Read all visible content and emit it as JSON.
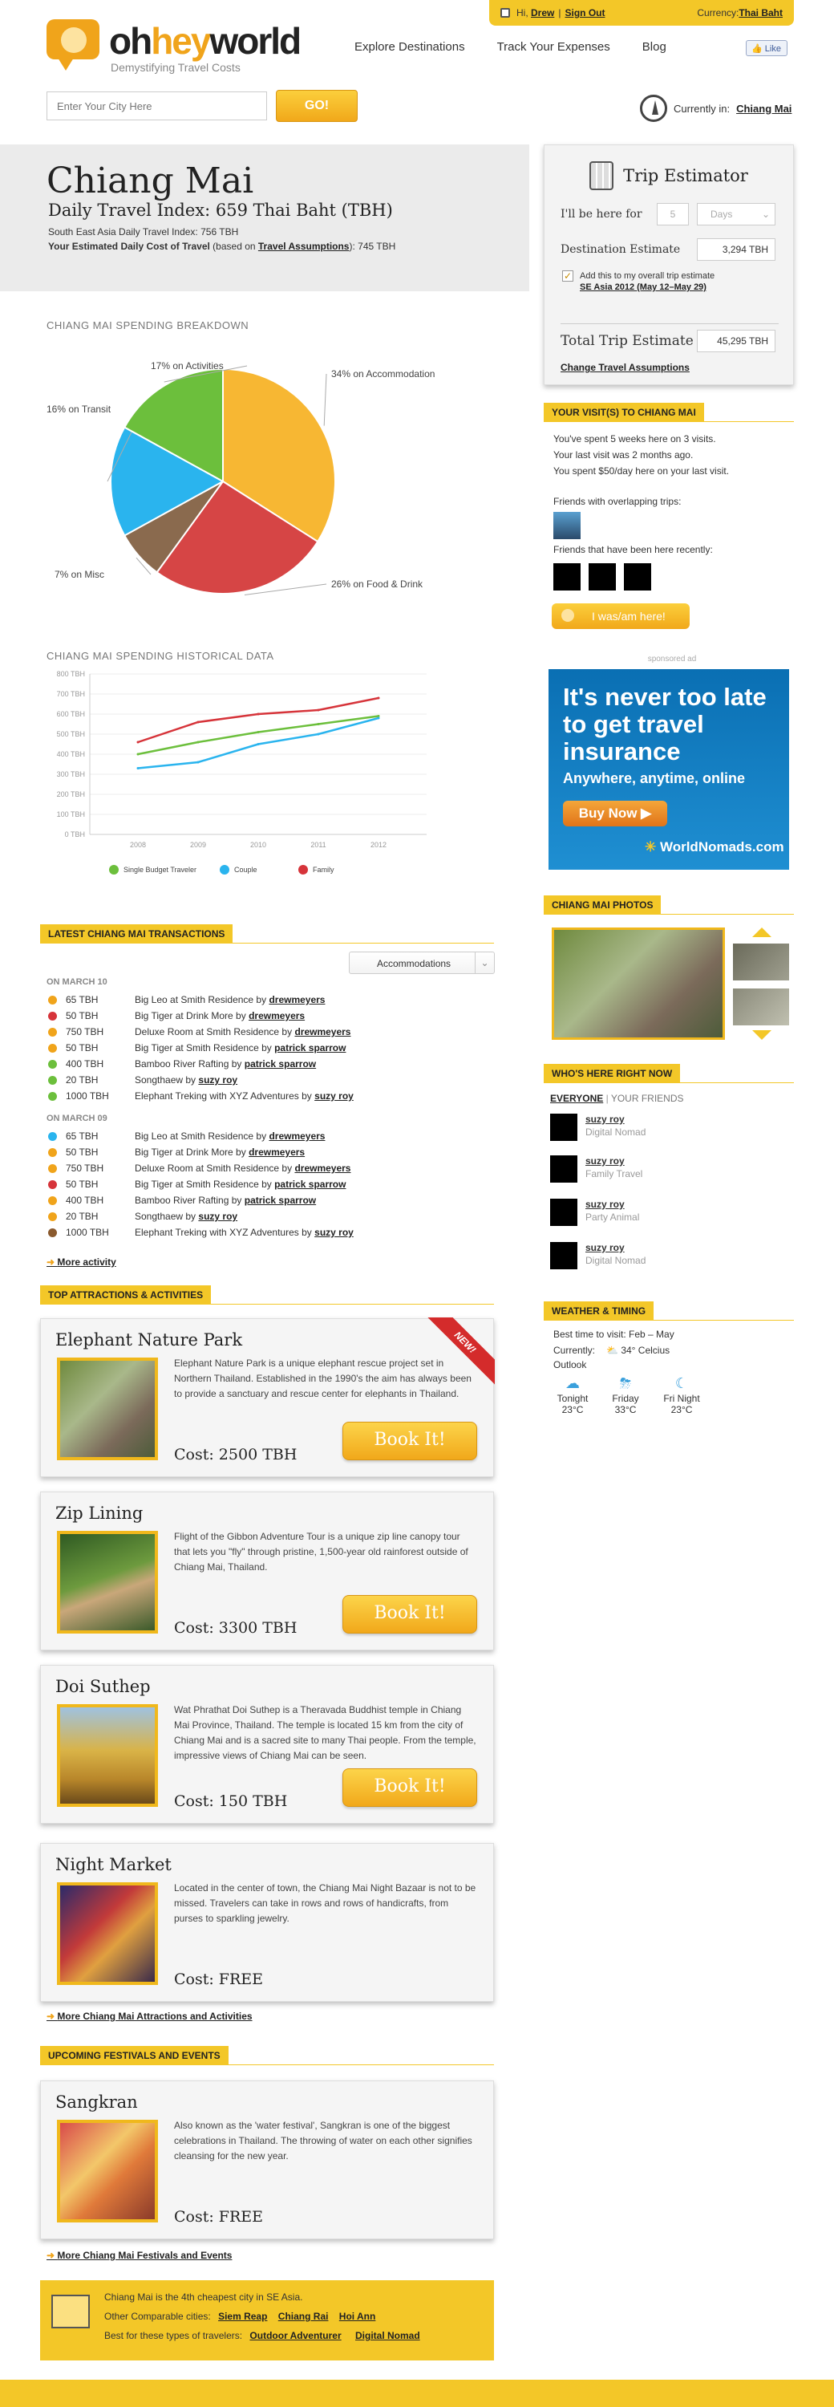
{
  "userbar": {
    "greeting": "Hi,",
    "user": "Drew",
    "signout": "Sign Out",
    "currency_label": "Currency:",
    "currency": "Thai Baht"
  },
  "header": {
    "logo_oh": "oh",
    "logo_hey": "hey",
    "logo_world": "world",
    "tagline": "Demystifying Travel Costs",
    "nav": [
      "Explore Destinations",
      "Track Your Expenses",
      "Blog"
    ],
    "like": "Like",
    "search_placeholder": "Enter Your City Here",
    "go": "GO!",
    "currently_in_label": "Currently in:",
    "currently_in_city": "Chiang Mai"
  },
  "city": {
    "name": "Chiang Mai",
    "daily_index": "Daily Travel Index: 659 Thai Baht (TBH)",
    "sea_index": "South East Asia Daily Travel Index: 756 TBH",
    "est_prefix": "Your Estimated Daily Cost of Travel",
    "est_mid": " (based on ",
    "est_link": "Travel Assumptions",
    "est_suffix": "): 745 TBH"
  },
  "estimator": {
    "title": "Trip Estimator",
    "here_for": "I'll be here for",
    "days_value": "5",
    "days_unit": "Days",
    "dest_label": "Destination Estimate",
    "dest_value": "3,294 TBH",
    "add_text": "Add this to my overall trip estimate",
    "add_link": "SE Asia 2012 (May 12–May 29)",
    "total_label": "Total Trip Estimate",
    "total_value": "45,295 TBH",
    "change_link": "Change Travel Assumptions"
  },
  "breakdown": {
    "title": "CHIANG MAI SPENDING BREAKDOWN"
  },
  "chart_data": [
    {
      "type": "pie",
      "title": "CHIANG MAI SPENDING BREAKDOWN",
      "slices": [
        {
          "label": "34% on Accommodation",
          "value": 34,
          "color": "#f7b733"
        },
        {
          "label": "26% on Food & Drink",
          "value": 26,
          "color": "#d64545"
        },
        {
          "label": "7% on Misc",
          "value": 7,
          "color": "#8a6a4e"
        },
        {
          "label": "16% on Transit",
          "value": 16,
          "color": "#2ab4ee"
        },
        {
          "label": "17% on Activities",
          "value": 17,
          "color": "#6cbf3c"
        }
      ]
    },
    {
      "type": "line",
      "title": "CHIANG MAI SPENDING HISTORICAL DATA",
      "x": [
        "2008",
        "2009",
        "2010",
        "2011",
        "2012"
      ],
      "y_ticks": [
        "0 TBH",
        "100 TBH",
        "200 TBH",
        "300 TBH",
        "400 TBH",
        "500 TBH",
        "600 TBH",
        "700 TBH",
        "800 TBH"
      ],
      "ylim": [
        0,
        800
      ],
      "series": [
        {
          "name": "Single Budget Traveler",
          "color": "#6cbf3c",
          "values": [
            400,
            460,
            510,
            550,
            590
          ]
        },
        {
          "name": "Couple",
          "color": "#2ab4ee",
          "values": [
            330,
            360,
            450,
            500,
            580
          ]
        },
        {
          "name": "Family",
          "color": "#d6343a",
          "values": [
            460,
            560,
            600,
            620,
            680
          ]
        }
      ]
    }
  ],
  "history": {
    "title": "CHIANG MAI SPENDING HISTORICAL DATA"
  },
  "transactions": {
    "title": "LATEST CHIANG MAI TRANSACTIONS",
    "filter": "Accommodations",
    "groups": [
      {
        "date": "ON MARCH 10",
        "rows": [
          {
            "color": "#f0a41b",
            "amt": "65 TBH",
            "desc": "Big Leo at Smith Residence by",
            "user": "drewmeyers"
          },
          {
            "color": "#d6343a",
            "amt": "50 TBH",
            "desc": "Big Tiger at Drink More by",
            "user": "drewmeyers"
          },
          {
            "color": "#f0a41b",
            "amt": "750 TBH",
            "desc": "Deluxe Room at Smith Residence by",
            "user": "drewmeyers"
          },
          {
            "color": "#f0a41b",
            "amt": "50 TBH",
            "desc": "Big Tiger at Smith Residence by",
            "user": "patrick sparrow"
          },
          {
            "color": "#6cbf3c",
            "amt": "400 TBH",
            "desc": "Bamboo River Rafting by",
            "user": "patrick sparrow"
          },
          {
            "color": "#6cbf3c",
            "amt": "20 TBH",
            "desc": "Songthaew by",
            "user": "suzy roy"
          },
          {
            "color": "#6cbf3c",
            "amt": "1000 TBH",
            "desc": "Elephant Treking with XYZ Adventures by",
            "user": "suzy roy"
          }
        ]
      },
      {
        "date": "ON MARCH 09",
        "rows": [
          {
            "color": "#2ab4ee",
            "amt": "65 TBH",
            "desc": "Big Leo at Smith Residence by",
            "user": "drewmeyers"
          },
          {
            "color": "#f0a41b",
            "amt": "50 TBH",
            "desc": "Big Tiger at Drink More by",
            "user": "drewmeyers"
          },
          {
            "color": "#f0a41b",
            "amt": "750 TBH",
            "desc": "Deluxe Room at Smith Residence by",
            "user": "drewmeyers"
          },
          {
            "color": "#d6343a",
            "amt": "50 TBH",
            "desc": "Big Tiger at Smith Residence by",
            "user": "patrick sparrow"
          },
          {
            "color": "#f0a41b",
            "amt": "400 TBH",
            "desc": "Bamboo River Rafting by",
            "user": "patrick sparrow"
          },
          {
            "color": "#f0a41b",
            "amt": "20 TBH",
            "desc": "Songthaew by",
            "user": "suzy roy"
          },
          {
            "color": "#8a5a2e",
            "amt": "1000 TBH",
            "desc": "Elephant Treking with XYZ Adventures by",
            "user": "suzy roy"
          }
        ]
      }
    ],
    "more": "More activity"
  },
  "attractions": {
    "title": "TOP ATTRACTIONS & ACTIVITIES",
    "items": [
      {
        "name": "Elephant Nature Park",
        "desc": "Elephant Nature Park is a unique elephant rescue project set in Northern Thailand. Established in the 1990's the aim has always been to provide a sanctuary and rescue center for elephants in Thailand.",
        "cost": "Cost: 2500 TBH",
        "book": "Book It!",
        "badge": "NEW!"
      },
      {
        "name": "Zip Lining",
        "desc": "Flight of the Gibbon Adventure Tour is a unique zip line canopy tour that lets you \"fly\" through pristine, 1,500-year old rainforest outside of Chiang Mai, Thailand.",
        "cost": "Cost: 3300 TBH",
        "book": "Book It!"
      },
      {
        "name": "Doi Suthep",
        "desc": "Wat Phrathat Doi Suthep is a Theravada Buddhist temple in Chiang Mai Province, Thailand. The temple is located 15 km from the city of Chiang Mai and is a sacred site to many Thai people. From the temple, impressive views of Chiang Mai can be seen.",
        "cost": "Cost: 150 TBH",
        "book": "Book It!"
      },
      {
        "name": "Night Market",
        "desc": "Located in the center of town, the Chiang Mai Night Bazaar is not to be missed. Travelers can take in rows and rows of handicrafts, from purses to sparkling jewelry.",
        "cost": "Cost: FREE"
      }
    ],
    "more": "More Chiang Mai Attractions and Activities"
  },
  "festivals": {
    "title": "UPCOMING FESTIVALS AND EVENTS",
    "item": {
      "name": "Sangkran",
      "desc": "Also known as the 'water festival', Sangkran is one of the biggest celebrations in Thailand.  The throwing of water on each other signifies cleansing for the new year.",
      "cost": "Cost: FREE"
    },
    "more": "More Chiang Mai Festivals and Events"
  },
  "footer": {
    "line1": "Chiang Mai is the 4th cheapest city in SE Asia.",
    "comparable_label": "Other Comparable cities:",
    "cities": [
      "Siem Reap",
      "Chiang Rai",
      "Hoi Ann"
    ],
    "best_label": "Best for these types of travelers:",
    "types": [
      "Outdoor Adventurer",
      "Digital Nomad"
    ]
  },
  "sidebar": {
    "visits_title": "YOUR VISIT(S) TO CHIANG MAI",
    "visits_lines": [
      "You've spent 5 weeks here on 3 visits.",
      "Your last visit was 2 months ago.",
      "You spent $50/day here on your last visit."
    ],
    "overlap_label": "Friends with overlapping trips:",
    "recent_label": "Friends that have been here recently:",
    "iwas": "I was/am here!",
    "sponsored": "sponsored ad",
    "ad_title": "It's never too late to get travel insurance",
    "ad_sub": "Anywhere, anytime, online",
    "ad_buy": "Buy Now ▶",
    "ad_brand": "WorldNomads.com",
    "photos_title": "CHIANG MAI PHOTOS",
    "here_title": "WHO'S HERE RIGHT NOW",
    "here_tab_everyone": "EVERYONE",
    "here_tab_sep": "|",
    "here_tab_friends": "YOUR FRIENDS",
    "here_people": [
      {
        "name": "suzy roy",
        "type": "Digital Nomad"
      },
      {
        "name": "suzy roy",
        "type": "Family Travel"
      },
      {
        "name": "suzy roy",
        "type": "Party Animal"
      },
      {
        "name": "suzy roy",
        "type": "Digital Nomad"
      }
    ],
    "weather_title": "WEATHER & TIMING",
    "best_time": "Best time to visit: Feb – May",
    "currently_label": "Currently:",
    "currently_value": "34° Celcius",
    "outlook": "Outlook",
    "forecast": [
      {
        "day": "Tonight",
        "temp": "23°C",
        "icon": "cloud-icon"
      },
      {
        "day": "Friday",
        "temp": "33°C",
        "icon": "storm-icon"
      },
      {
        "day": "Fri Night",
        "temp": "23°C",
        "icon": "moon-icon"
      }
    ]
  }
}
